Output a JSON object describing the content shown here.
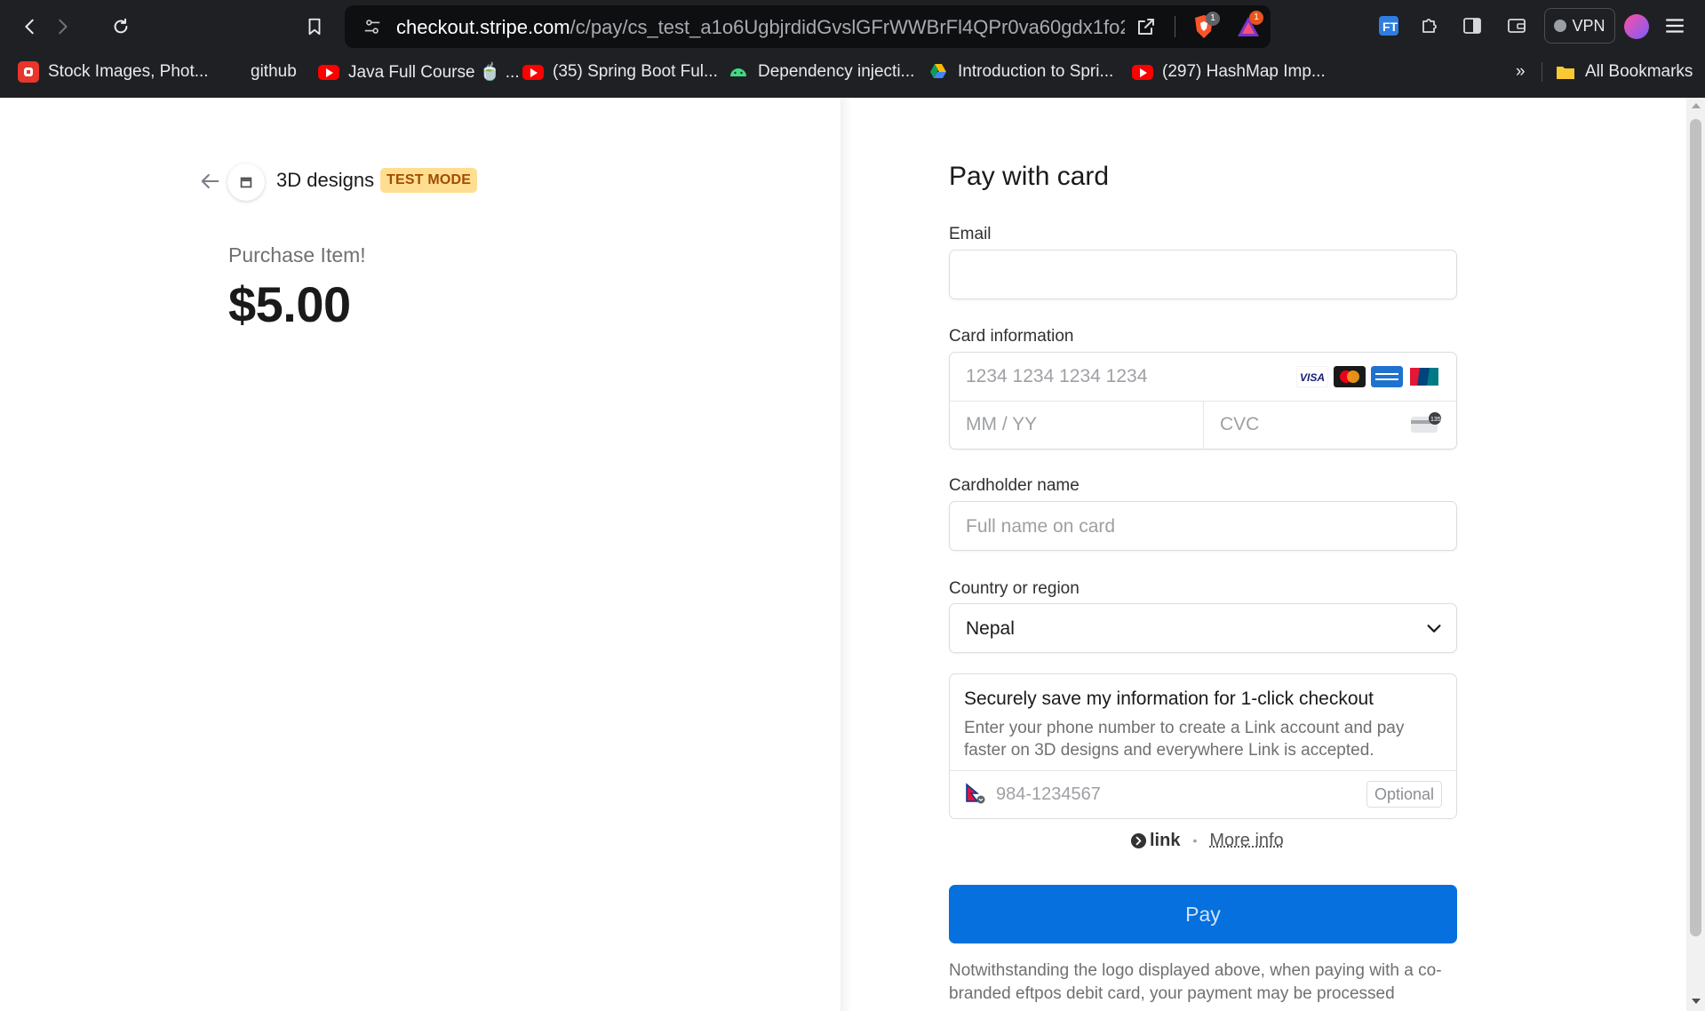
{
  "browser": {
    "url_host": "checkout.stripe.com",
    "url_path": "/c/pay/cs_test_a1o6UgbjrdidGvslGFrWWBrFl4QPr0va60gdx1fo2uG...",
    "shield_badge": "1",
    "rewards_badge": "1",
    "vpn_label": "VPN",
    "bookmarks": [
      {
        "label": "Stock Images, Phot...",
        "icon": "red-app-icon"
      },
      {
        "label": "github",
        "icon": "github-icon"
      },
      {
        "label": "Java Full Course 🍵 ...",
        "icon": "youtube-icon"
      },
      {
        "label": "(35) Spring Boot Ful...",
        "icon": "youtube-icon"
      },
      {
        "label": "Dependency injecti...",
        "icon": "android-icon"
      },
      {
        "label": "Introduction to Spri...",
        "icon": "gdrive-icon"
      },
      {
        "label": "(297) HashMap Imp...",
        "icon": "youtube-icon"
      }
    ],
    "overflow_label": "»",
    "all_bookmarks_label": "All Bookmarks"
  },
  "merchant": {
    "name": "3D designs",
    "test_mode_label": "TEST MODE"
  },
  "product": {
    "name": "Purchase Item!",
    "price": "$5.00"
  },
  "form": {
    "title": "Pay with card",
    "email_label": "Email",
    "email_value": "",
    "card_label": "Card information",
    "card_number_placeholder": "1234 1234 1234 1234",
    "expiry_placeholder": "MM / YY",
    "cvc_placeholder": "CVC",
    "card_brands": [
      "visa",
      "mastercard",
      "amex",
      "unionpay"
    ],
    "visa_text": "VISA",
    "cvc_hint": "135",
    "cardholder_label": "Cardholder name",
    "cardholder_placeholder": "Full name on card",
    "country_label": "Country or region",
    "country_value": "Nepal",
    "link_title": "Securely save my information for 1-click checkout",
    "link_description": "Enter your phone number to create a Link account and pay faster on 3D designs and everywhere Link is accepted.",
    "phone_placeholder": "984-1234567",
    "optional_label": "Optional",
    "link_brand": "link",
    "dot": "•",
    "more_info": "More info",
    "pay_label": "Pay",
    "notice": "Notwithstanding the logo displayed above, when paying with a co-branded eftpos debit card, your payment may be processed"
  },
  "colors": {
    "pay_button": "#0570de",
    "test_badge_bg": "#ffde92",
    "test_badge_text": "#a14d00"
  }
}
